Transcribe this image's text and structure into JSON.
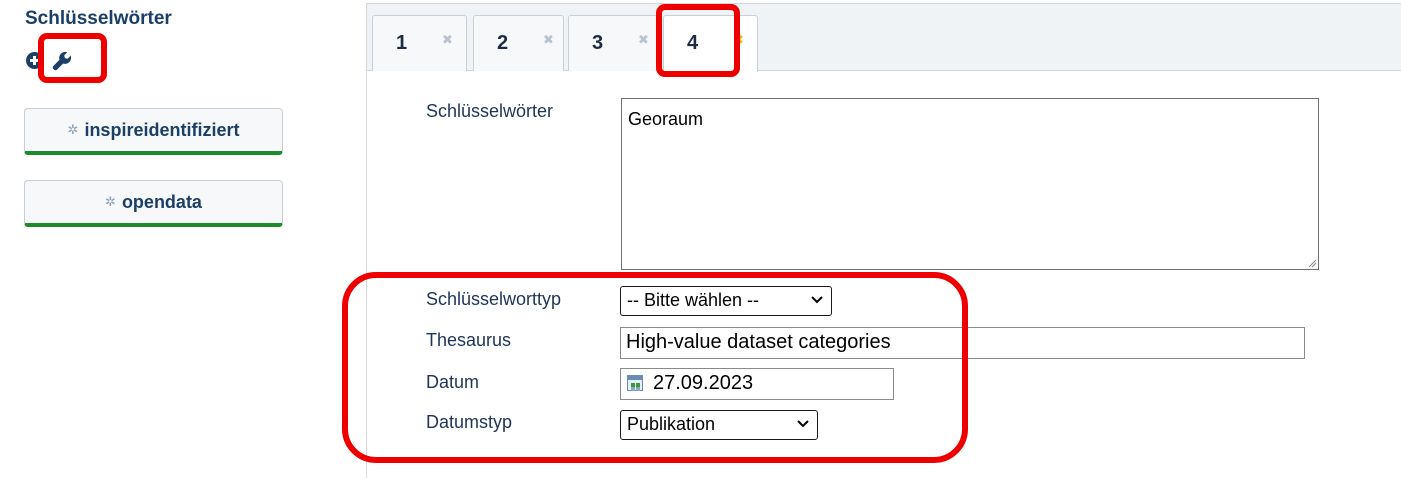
{
  "sidebar": {
    "title": "Schlüsselwörter",
    "tool_icons": [
      "plus-circle-icon",
      "wrench-icon"
    ],
    "buttons": [
      {
        "label": "inspireidentifiziert",
        "icon": "gear-icon"
      },
      {
        "label": "opendata",
        "icon": "gear-icon"
      }
    ]
  },
  "tabs": [
    {
      "label": "1",
      "close": "✖",
      "active": false
    },
    {
      "label": "2",
      "close": "✖",
      "active": false
    },
    {
      "label": "3",
      "close": "✖",
      "active": false
    },
    {
      "label": "4",
      "close": "✖",
      "active": true
    }
  ],
  "form": {
    "keywords": {
      "label": "Schlüsselwörter",
      "value": "Georaum"
    },
    "keyword_type": {
      "label": "Schlüsselworttyp",
      "value": "-- Bitte wählen --"
    },
    "thesaurus": {
      "label": "Thesaurus",
      "value": "High-value dataset categories"
    },
    "date": {
      "label": "Datum",
      "value": "27.09.2023"
    },
    "date_type": {
      "label": "Datumstyp",
      "value": "Publikation"
    }
  },
  "colors": {
    "highlight": "#ee0000",
    "button_accent": "#1e8a2e",
    "active_tab_close": "#f2b600",
    "heading": "#1b3f66"
  }
}
